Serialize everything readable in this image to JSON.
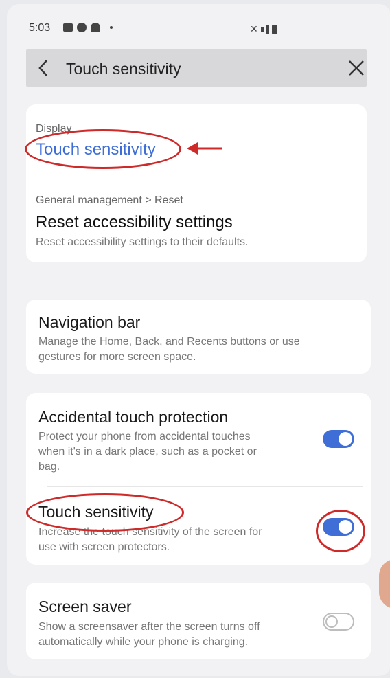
{
  "status_bar": {
    "time": "5:03"
  },
  "search_bar": {
    "query": "Touch sensitivity"
  },
  "results": [
    {
      "breadcrumb": "Display",
      "title": "Touch sensitivity"
    },
    {
      "breadcrumb": "General management > Reset",
      "title": "Reset accessibility settings",
      "description": "Reset accessibility settings to their defaults."
    }
  ],
  "settings": {
    "navigation_bar": {
      "title": "Navigation bar",
      "description_line1": "Manage the Home, Back, and Recents buttons or use",
      "description_line2": "gestures for more screen space."
    },
    "accidental_touch": {
      "title": "Accidental touch protection",
      "description_line1": "Protect your phone from accidental touches",
      "description_line2": "when it's in a dark place, such as a pocket or",
      "description_line3": "bag.",
      "enabled": true
    },
    "touch_sensitivity": {
      "title": "Touch sensitivity",
      "description_line1": "Increase the touch sensitivity of the screen for",
      "description_line2": "use with screen protectors.",
      "enabled": true
    },
    "screen_saver": {
      "title": "Screen saver",
      "description_line1": "Show a screensaver after the screen turns off",
      "description_line2": "automatically while your phone is charging.",
      "enabled": false
    }
  },
  "colors": {
    "accent": "#3f6fd6",
    "annotation": "#cf2a2a"
  }
}
